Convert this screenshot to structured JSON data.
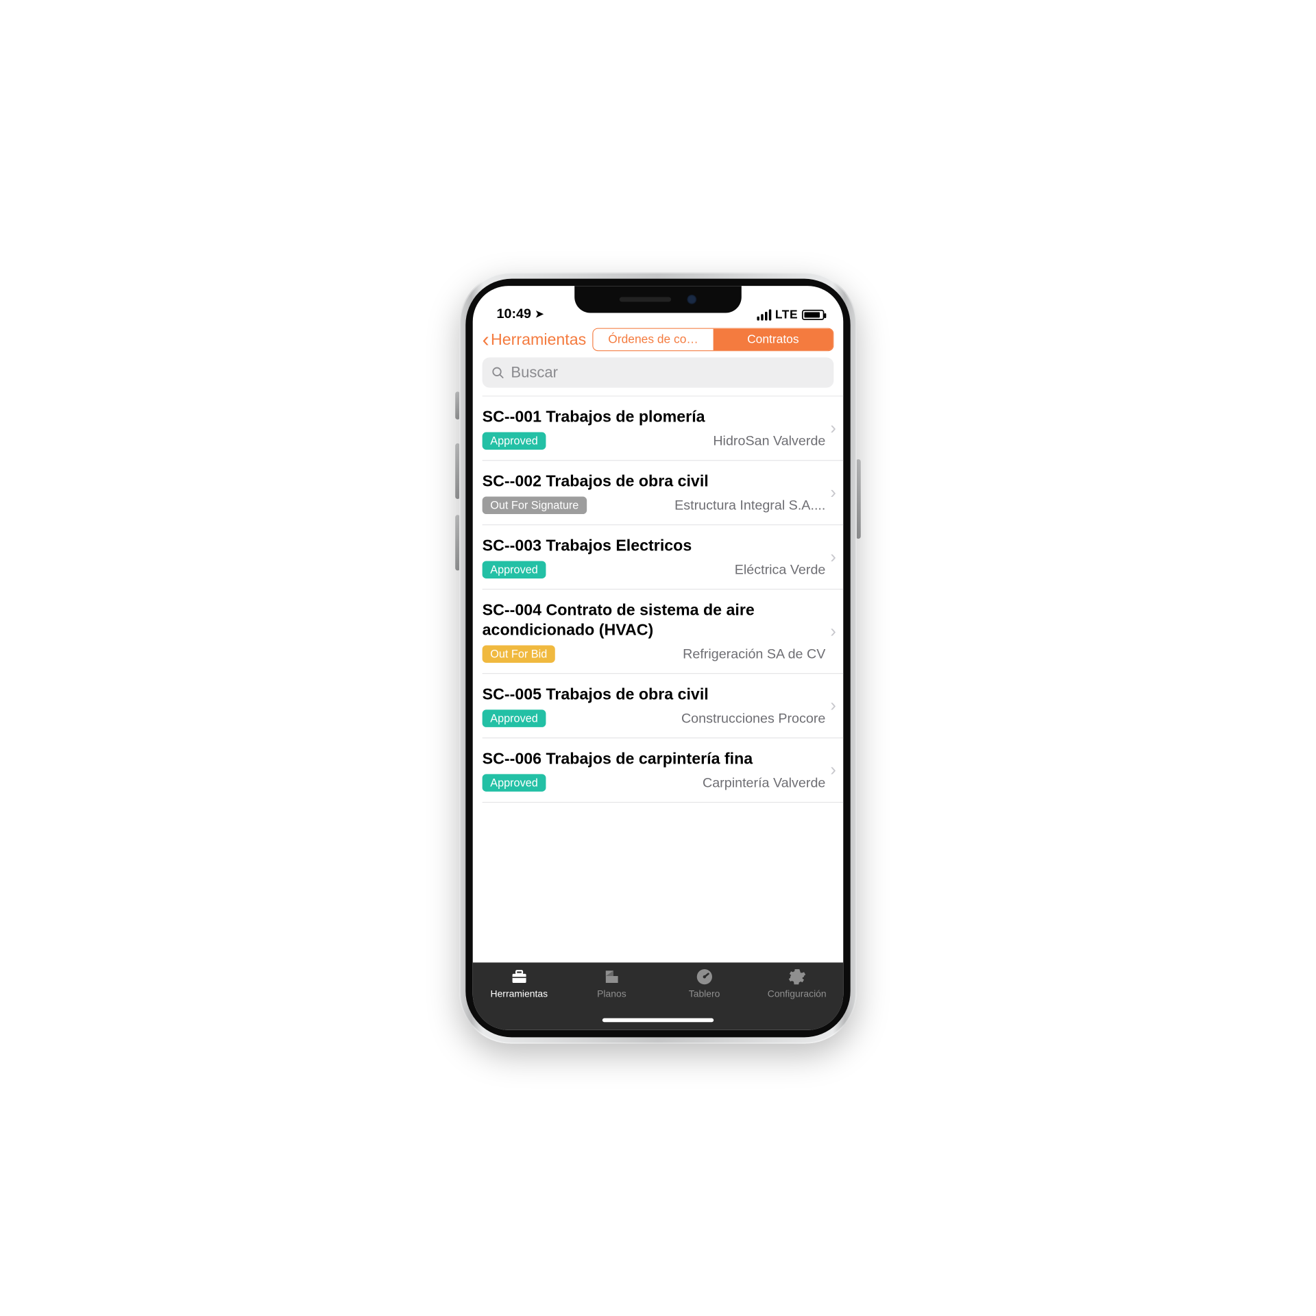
{
  "status": {
    "time": "10:49",
    "network": "LTE"
  },
  "nav": {
    "back_label": "Herramientas",
    "segments": {
      "orders": "Órdenes de co…",
      "contracts": "Contratos"
    }
  },
  "search": {
    "placeholder": "Buscar"
  },
  "badges": {
    "approved": "Approved",
    "signature": "Out For Signature",
    "bid": "Out For Bid"
  },
  "contracts": [
    {
      "title": "SC--001 Trabajos de plomería",
      "status": "approved",
      "company": "HidroSan Valverde"
    },
    {
      "title": "SC--002 Trabajos de obra civil",
      "status": "signature",
      "company": "Estructura Integral S.A...."
    },
    {
      "title": "SC--003 Trabajos Electricos",
      "status": "approved",
      "company": "Eléctrica Verde"
    },
    {
      "title": "SC--004 Contrato de sistema de aire acondicionado (HVAC)",
      "status": "bid",
      "company": "Refrigeración SA de CV"
    },
    {
      "title": "SC--005 Trabajos de obra civil",
      "status": "approved",
      "company": "Construcciones Procore"
    },
    {
      "title": "SC--006 Trabajos de carpintería fina",
      "status": "approved",
      "company": "Carpintería Valverde"
    }
  ],
  "tabs": {
    "tools": "Herramientas",
    "plans": "Planos",
    "dashboard": "Tablero",
    "settings": "Configuración"
  }
}
